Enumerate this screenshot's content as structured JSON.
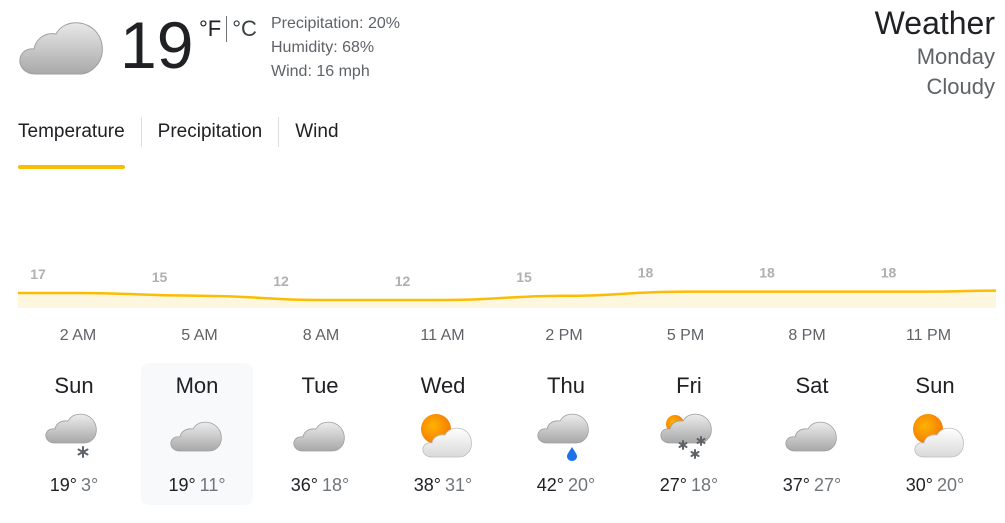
{
  "current": {
    "temp": "19",
    "unit_f": "°F",
    "unit_c": "°C",
    "condition_icon": "cloudy-icon",
    "precipitation": "Precipitation: 20%",
    "humidity": "Humidity: 68%",
    "wind": "Wind: 16 mph"
  },
  "header": {
    "title": "Weather",
    "day": "Monday",
    "condition": "Cloudy"
  },
  "tabs": [
    {
      "label": "Temperature",
      "active": true
    },
    {
      "label": "Precipitation",
      "active": false
    },
    {
      "label": "Wind",
      "active": false
    }
  ],
  "colors": {
    "accent": "#fbbc04",
    "chart_fill": "#fef7e0",
    "rain": "#1a73e8"
  },
  "chart_data": {
    "type": "area",
    "x": [
      "2 AM",
      "5 AM",
      "8 AM",
      "11 AM",
      "2 PM",
      "5 PM",
      "8 PM",
      "11 PM"
    ],
    "values": [
      17,
      15,
      12,
      12,
      15,
      18,
      18,
      18
    ],
    "value_labels": [
      "17",
      "15",
      "12",
      "12",
      "15",
      "18",
      "18",
      "18"
    ],
    "xlabel": "",
    "ylabel": ""
  },
  "days": [
    {
      "name": "Sun",
      "icon": "snow-cloud-icon",
      "hi": "19°",
      "lo": "3°",
      "selected": false
    },
    {
      "name": "Mon",
      "icon": "cloudy-icon",
      "hi": "19°",
      "lo": "11°",
      "selected": true
    },
    {
      "name": "Tue",
      "icon": "cloudy-icon",
      "hi": "36°",
      "lo": "18°",
      "selected": false
    },
    {
      "name": "Wed",
      "icon": "partly-cloudy-icon",
      "hi": "38°",
      "lo": "31°",
      "selected": false
    },
    {
      "name": "Thu",
      "icon": "rain-cloud-icon",
      "hi": "42°",
      "lo": "20°",
      "selected": false
    },
    {
      "name": "Fri",
      "icon": "snow-showers-icon",
      "hi": "27°",
      "lo": "18°",
      "selected": false
    },
    {
      "name": "Sat",
      "icon": "cloudy-icon",
      "hi": "37°",
      "lo": "27°",
      "selected": false
    },
    {
      "name": "Sun",
      "icon": "partly-cloudy-icon",
      "hi": "30°",
      "lo": "20°",
      "selected": false
    }
  ]
}
